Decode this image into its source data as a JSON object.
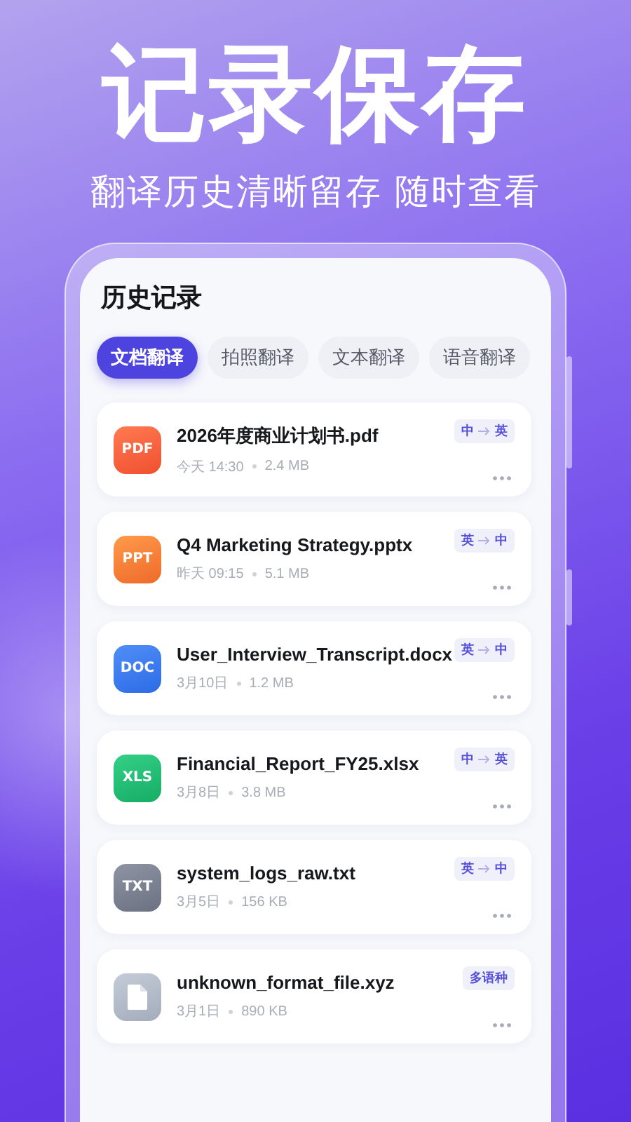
{
  "headline": "记录保存",
  "subtitle": "翻译历史清晰留存 随时查看",
  "panel": {
    "title": "历史记录"
  },
  "tabs": [
    {
      "label": "文档翻译",
      "selected": true
    },
    {
      "label": "拍照翻译",
      "selected": false
    },
    {
      "label": "文本翻译",
      "selected": false
    },
    {
      "label": "语音翻译",
      "selected": false
    }
  ],
  "files": [
    {
      "kind": "pdf",
      "badge": "PDF",
      "name": "2026年度商业计划书.pdf",
      "date": "今天 14:30",
      "size": "2.4 MB",
      "lang": {
        "kind": "pair",
        "from": "中",
        "to": "英"
      }
    },
    {
      "kind": "ppt",
      "badge": "PPT",
      "name": "Q4 Marketing Strategy.pptx",
      "date": "昨天 09:15",
      "size": "5.1 MB",
      "lang": {
        "kind": "pair",
        "from": "英",
        "to": "中"
      }
    },
    {
      "kind": "doc",
      "badge": "DOC",
      "name": "User_Interview_Transcript.docx",
      "date": "3月10日",
      "size": "1.2 MB",
      "lang": {
        "kind": "pair",
        "from": "英",
        "to": "中"
      }
    },
    {
      "kind": "xls",
      "badge": "XLS",
      "name": "Financial_Report_FY25.xlsx",
      "date": "3月8日",
      "size": "3.8 MB",
      "lang": {
        "kind": "pair",
        "from": "中",
        "to": "英"
      }
    },
    {
      "kind": "txt",
      "badge": "TXT",
      "name": "system_logs_raw.txt",
      "date": "3月5日",
      "size": "156 KB",
      "lang": {
        "kind": "pair",
        "from": "英",
        "to": "中"
      }
    },
    {
      "kind": "unknown",
      "name": "unknown_format_file.xyz",
      "date": "3月1日",
      "size": "890 KB",
      "lang": {
        "kind": "multi",
        "label": "多语种"
      }
    }
  ]
}
